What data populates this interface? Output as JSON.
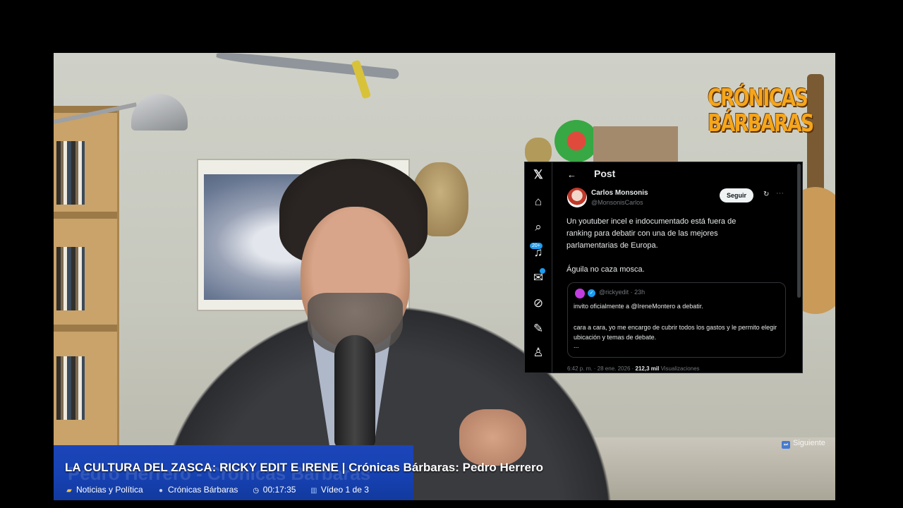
{
  "logo": {
    "line1": "CRÓNICAS",
    "line2": "BÁRBARAS"
  },
  "post": {
    "header": "Post",
    "author_name": "Carlos Monsonis",
    "author_handle": "@MonsonisCarlos",
    "follow_label": "Seguir",
    "text": "Un youtuber incel e indocumentado está fuera de ranking para debatir con una de las mejores parlamentarias de Europa.",
    "text2": "Águila no caza mosca.",
    "rail_badge": "20+",
    "quote": {
      "meta": "@rickyedit · 23h",
      "line1": "invito oficialmente a @IreneMontero a debatir.",
      "line2": "cara a cara, yo me encargo de cubrir todos los gastos y le permito elegir ubicación y temas de debate.",
      "more": "..."
    },
    "footer_prefix": "6:42 p. m. · 28 ene. 2026 ·",
    "footer_views": "212,3 mil",
    "footer_suffix": "Visualizaciones"
  },
  "next_label": "Siguiente",
  "video": {
    "title": "LA CULTURA DEL ZASCA: RICKY EDIT E IRENE | Crónicas Bárbaras: Pedro Herrero",
    "ghost_text": "Pedro Herrero - Crónicas Bárbaras",
    "category": "Noticias y Política",
    "channel": "Crónicas Bárbaras",
    "duration": "00:17:35",
    "position": "Vídeo 1 de 3"
  }
}
